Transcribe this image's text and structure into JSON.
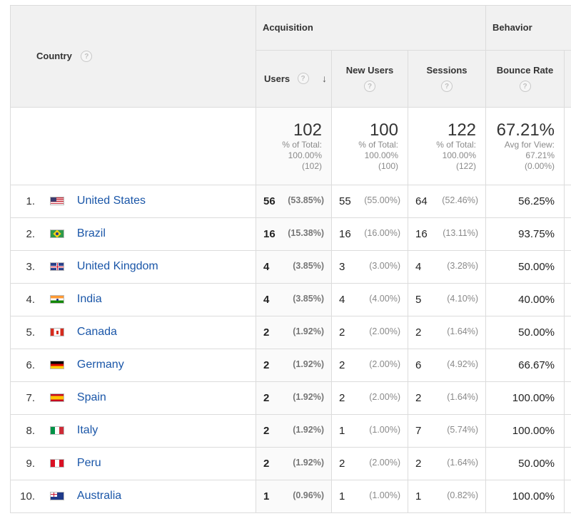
{
  "header": {
    "country_label": "Country",
    "acquisition_label": "Acquisition",
    "behavior_label": "Behavior",
    "help_glyph": "?",
    "sort_arrow": "↓",
    "columns": {
      "users": "Users",
      "new_users": "New Users",
      "sessions": "Sessions",
      "bounce_rate": "Bounce Rate"
    }
  },
  "totals": {
    "users": {
      "value": "102",
      "line1": "% of Total:",
      "line2": "100.00%",
      "line3": "(102)"
    },
    "new_users": {
      "value": "100",
      "line1": "% of Total:",
      "line2": "100.00%",
      "line3": "(100)"
    },
    "sessions": {
      "value": "122",
      "line1": "% of Total:",
      "line2": "100.00%",
      "line3": "(122)"
    },
    "bounce_rate": {
      "value": "67.21%",
      "line1": "Avg for View:",
      "line2": "67.21%",
      "line3": "(0.00%)"
    }
  },
  "rows": [
    {
      "rank": "1.",
      "country": "United States",
      "flag": "us",
      "users": "56",
      "users_pct": "(53.85%)",
      "new_users": "55",
      "new_users_pct": "(55.00%)",
      "sessions": "64",
      "sessions_pct": "(52.46%)",
      "bounce": "56.25%"
    },
    {
      "rank": "2.",
      "country": "Brazil",
      "flag": "br",
      "users": "16",
      "users_pct": "(15.38%)",
      "new_users": "16",
      "new_users_pct": "(16.00%)",
      "sessions": "16",
      "sessions_pct": "(13.11%)",
      "bounce": "93.75%"
    },
    {
      "rank": "3.",
      "country": "United Kingdom",
      "flag": "gb",
      "users": "4",
      "users_pct": "(3.85%)",
      "new_users": "3",
      "new_users_pct": "(3.00%)",
      "sessions": "4",
      "sessions_pct": "(3.28%)",
      "bounce": "50.00%"
    },
    {
      "rank": "4.",
      "country": "India",
      "flag": "in",
      "users": "4",
      "users_pct": "(3.85%)",
      "new_users": "4",
      "new_users_pct": "(4.00%)",
      "sessions": "5",
      "sessions_pct": "(4.10%)",
      "bounce": "40.00%"
    },
    {
      "rank": "5.",
      "country": "Canada",
      "flag": "ca",
      "users": "2",
      "users_pct": "(1.92%)",
      "new_users": "2",
      "new_users_pct": "(2.00%)",
      "sessions": "2",
      "sessions_pct": "(1.64%)",
      "bounce": "50.00%"
    },
    {
      "rank": "6.",
      "country": "Germany",
      "flag": "de",
      "users": "2",
      "users_pct": "(1.92%)",
      "new_users": "2",
      "new_users_pct": "(2.00%)",
      "sessions": "6",
      "sessions_pct": "(4.92%)",
      "bounce": "66.67%"
    },
    {
      "rank": "7.",
      "country": "Spain",
      "flag": "es",
      "users": "2",
      "users_pct": "(1.92%)",
      "new_users": "2",
      "new_users_pct": "(2.00%)",
      "sessions": "2",
      "sessions_pct": "(1.64%)",
      "bounce": "100.00%"
    },
    {
      "rank": "8.",
      "country": "Italy",
      "flag": "it",
      "users": "2",
      "users_pct": "(1.92%)",
      "new_users": "1",
      "new_users_pct": "(1.00%)",
      "sessions": "7",
      "sessions_pct": "(5.74%)",
      "bounce": "100.00%"
    },
    {
      "rank": "9.",
      "country": "Peru",
      "flag": "pe",
      "users": "2",
      "users_pct": "(1.92%)",
      "new_users": "2",
      "new_users_pct": "(2.00%)",
      "sessions": "2",
      "sessions_pct": "(1.64%)",
      "bounce": "50.00%"
    },
    {
      "rank": "10.",
      "country": "Australia",
      "flag": "au",
      "users": "1",
      "users_pct": "(0.96%)",
      "new_users": "1",
      "new_users_pct": "(1.00%)",
      "sessions": "1",
      "sessions_pct": "(0.82%)",
      "bounce": "100.00%"
    }
  ]
}
